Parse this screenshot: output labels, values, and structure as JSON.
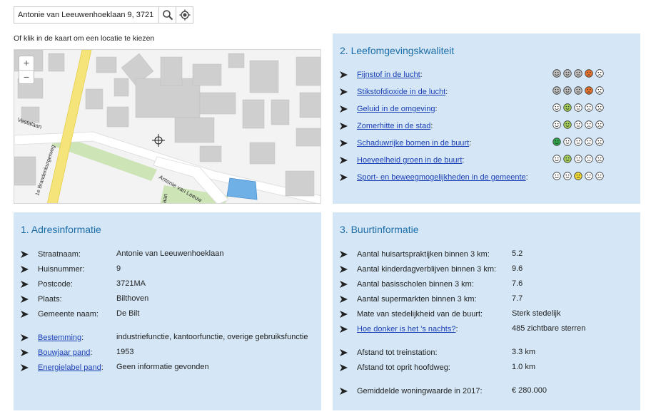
{
  "search": {
    "value": "Antonie van Leeuwenhoeklaan 9, 3721",
    "hint": "Of klik in de kaart om een locatie te kiezen"
  },
  "map": {
    "zoom_in": "+",
    "zoom_out": "−",
    "streets": {
      "vestalaan": "Vestalaan",
      "bunnikseweg": "1e Brandenburgerweg",
      "leeuwenhoeklaan": "Antonie van Leeuw",
      "leeuwen_cut": "laan"
    }
  },
  "colors": {
    "panel_bg": "#d5e7f6",
    "title": "#1d6ea8",
    "link": "#1a3fb5",
    "face_gray": "#bdbdbd",
    "face_orange": "#e8742d",
    "face_green_dark": "#2ea84a",
    "face_green_light": "#a8d25a",
    "face_yellow": "#f0d930"
  },
  "leefomgeving": {
    "title": "2. Leefomgevingskwaliteit",
    "items": [
      {
        "label": "Fijnstof in de lucht",
        "levels": [
          "gray",
          "gray",
          "gray",
          "orange",
          "none"
        ]
      },
      {
        "label": "Stikstofdioxide in de lucht",
        "levels": [
          "gray",
          "gray",
          "gray",
          "orange",
          "none"
        ]
      },
      {
        "label": "Geluid in de omgeving",
        "levels": [
          "none",
          "light-green",
          "none",
          "none",
          "none"
        ]
      },
      {
        "label": "Zomerhitte in de stad",
        "levels": [
          "none",
          "light-green",
          "none",
          "none",
          "none"
        ]
      },
      {
        "label": "Schaduwrijke bomen in de buurt",
        "levels": [
          "dark-green",
          "none",
          "none",
          "none",
          "none"
        ]
      },
      {
        "label": "Hoeveelheid groen in de buurt",
        "levels": [
          "none",
          "light-green",
          "none",
          "none",
          "none"
        ]
      },
      {
        "label": "Sport- en beweegmogelijkheden in de gemeente",
        "levels": [
          "none",
          "none",
          "yellow",
          "none",
          "none"
        ]
      }
    ]
  },
  "adres": {
    "title": "1. Adresinformatie",
    "rows": [
      {
        "label": "Straatnaam:",
        "value": "Antonie van Leeuwenhoeklaan",
        "link": false
      },
      {
        "label": "Huisnummer:",
        "value": "9",
        "link": false
      },
      {
        "label": "Postcode:",
        "value": "3721MA",
        "link": false
      },
      {
        "label": "Plaats:",
        "value": "Bilthoven",
        "link": false
      },
      {
        "label": "Gemeente naam:",
        "value": "De Bilt",
        "link": false
      },
      {
        "label": "Bestemming",
        "value": "industriefunctie, kantoorfunctie, overige gebruiksfunctie",
        "link": true
      },
      {
        "label": "Bouwjaar pand",
        "value": "1953",
        "link": true
      },
      {
        "label": "Energielabel pand",
        "value": "Geen informatie gevonden",
        "link": true
      }
    ]
  },
  "buurt": {
    "title": "3. Buurtinformatie",
    "rows": [
      {
        "label": "Aantal huisartspraktijken binnen 3 km:",
        "value": "5.2",
        "link": false
      },
      {
        "label": "Aantal kinderdagverblijven binnen 3 km:",
        "value": "9.6",
        "link": false
      },
      {
        "label": "Aantal basisscholen binnen 3 km:",
        "value": "7.6",
        "link": false
      },
      {
        "label": "Aantal supermarkten binnen 3 km:",
        "value": "7.7",
        "link": false
      },
      {
        "label": "Mate van stedelijkheid van de buurt:",
        "value": "Sterk stedelijk",
        "link": false
      },
      {
        "label": "Hoe donker is het 's nachts?",
        "value": "485 zichtbare sterren",
        "link": true
      },
      {
        "label": "Afstand tot treinstation:",
        "value": "3.3 km",
        "link": false
      },
      {
        "label": "Afstand tot oprit hoofdweg:",
        "value": "1.0 km",
        "link": false
      },
      {
        "label": "Gemiddelde woningwaarde in 2017:",
        "value": "€ 280.000",
        "link": false
      }
    ]
  }
}
